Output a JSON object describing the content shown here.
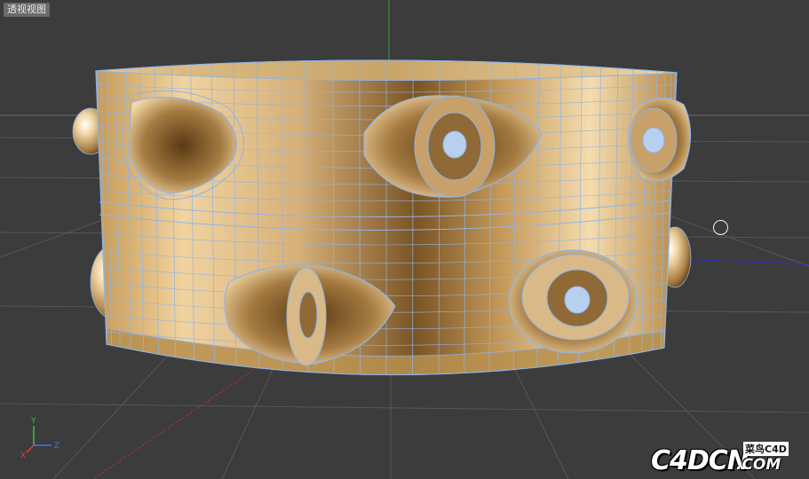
{
  "viewport": {
    "label": "透视视图"
  },
  "axis_widget": {
    "y_label": "Y",
    "z_label": "Z",
    "x_label": "X",
    "colors": {
      "y": "#39c339",
      "z": "#4a6cff",
      "x": "#e04040"
    }
  },
  "watermark": {
    "main_text": "C4DCN",
    "sub_text": "菜鸟C4D",
    "domain_text": ".COM"
  },
  "colors": {
    "background": "#3c3c3c",
    "grid": "#5a5a5a",
    "horizon": "#6a6a6a",
    "gold_light": "#f4d8a2",
    "gold_mid": "#c9a060",
    "gold_dark": "#6b4a1c",
    "wireframe": "#8fb4e8",
    "axis_y": "#3ca03c",
    "axis_x": "#c83a3a",
    "axis_z": "#3a3ad0"
  },
  "icons": {
    "cursor": "circle-cursor-icon",
    "axis": "axis-gizmo-icon"
  }
}
